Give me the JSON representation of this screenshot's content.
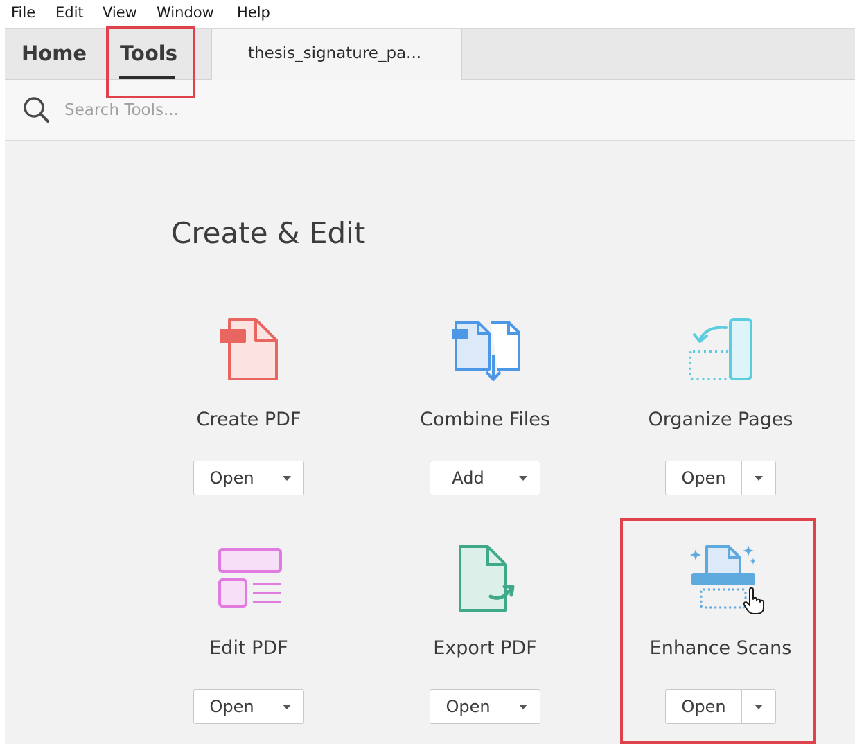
{
  "menu": {
    "file": "File",
    "edit": "Edit",
    "view": "View",
    "window": "Window",
    "help": "Help"
  },
  "tabs": {
    "home": "Home",
    "tools": "Tools",
    "document": "thesis_signature_pa..."
  },
  "search": {
    "placeholder": "Search Tools...",
    "icon": "search-icon"
  },
  "section": {
    "title": "Create & Edit"
  },
  "tools": [
    {
      "label": "Create PDF",
      "action": "Open",
      "icon": "create-pdf-icon",
      "color": "#e8665f"
    },
    {
      "label": "Combine Files",
      "action": "Add",
      "icon": "combine-files-icon",
      "color": "#4c98e6"
    },
    {
      "label": "Organize Pages",
      "action": "Open",
      "icon": "organize-pages-icon",
      "color": "#5ccde0"
    },
    {
      "label": "Edit PDF",
      "action": "Open",
      "icon": "edit-pdf-icon",
      "color": "#e07be0"
    },
    {
      "label": "Export PDF",
      "action": "Open",
      "icon": "export-pdf-icon",
      "color": "#3fa98a"
    },
    {
      "label": "Enhance Scans",
      "action": "Open",
      "icon": "enhance-scans-icon",
      "color": "#5ea9de"
    }
  ],
  "colors": {
    "highlight": "#e0424b"
  }
}
